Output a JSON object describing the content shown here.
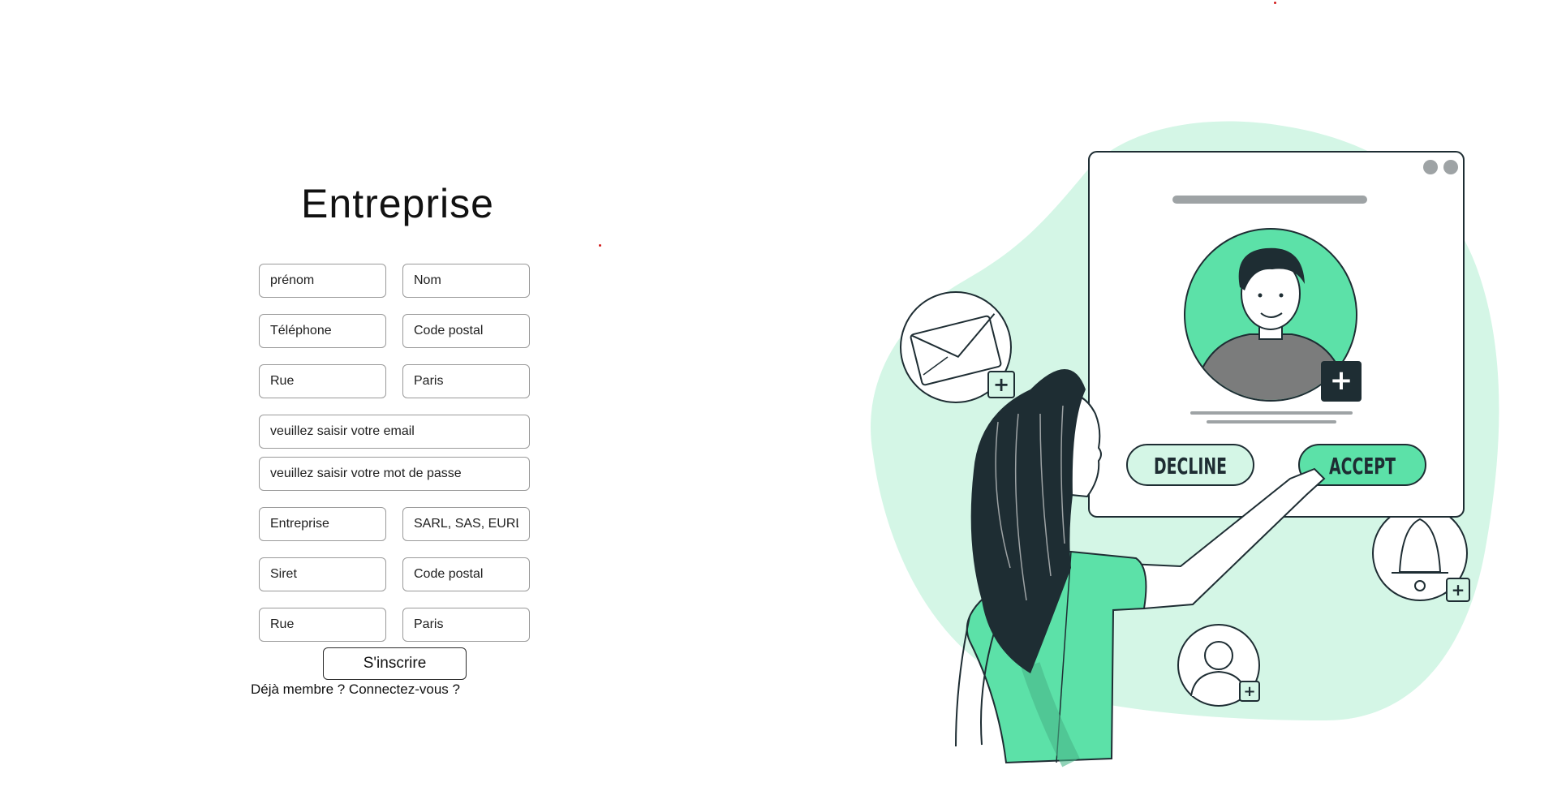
{
  "form": {
    "title": "Entreprise",
    "fields": {
      "prenom": "prénom",
      "nom": "Nom",
      "telephone": "Téléphone",
      "code_postal_1": "Code postal",
      "rue_1": "Rue",
      "ville_1": "Paris",
      "email": "veuillez saisir votre email",
      "password": "veuillez saisir votre mot de passe",
      "entreprise": "Entreprise",
      "forme_juridique": "SARL, SAS, EURL, ...",
      "siret": "Siret",
      "code_postal_2": "Code postal",
      "rue_2": "Rue",
      "ville_2": "Paris"
    },
    "submit_label": "S'inscrire",
    "login_link": "Déjà membre ? Connectez-vous ?"
  },
  "illustration": {
    "decline_label": "DECLINE",
    "accept_label": "ACCEPT",
    "icons": [
      "envelope-icon",
      "bell-icon",
      "user-icon",
      "plus-icon",
      "avatar-icon"
    ],
    "colors": {
      "accent": "#5ce1a8",
      "accent_light": "#d4f6e6",
      "dark": "#1e2d33",
      "grey": "#9ea3a5"
    }
  }
}
